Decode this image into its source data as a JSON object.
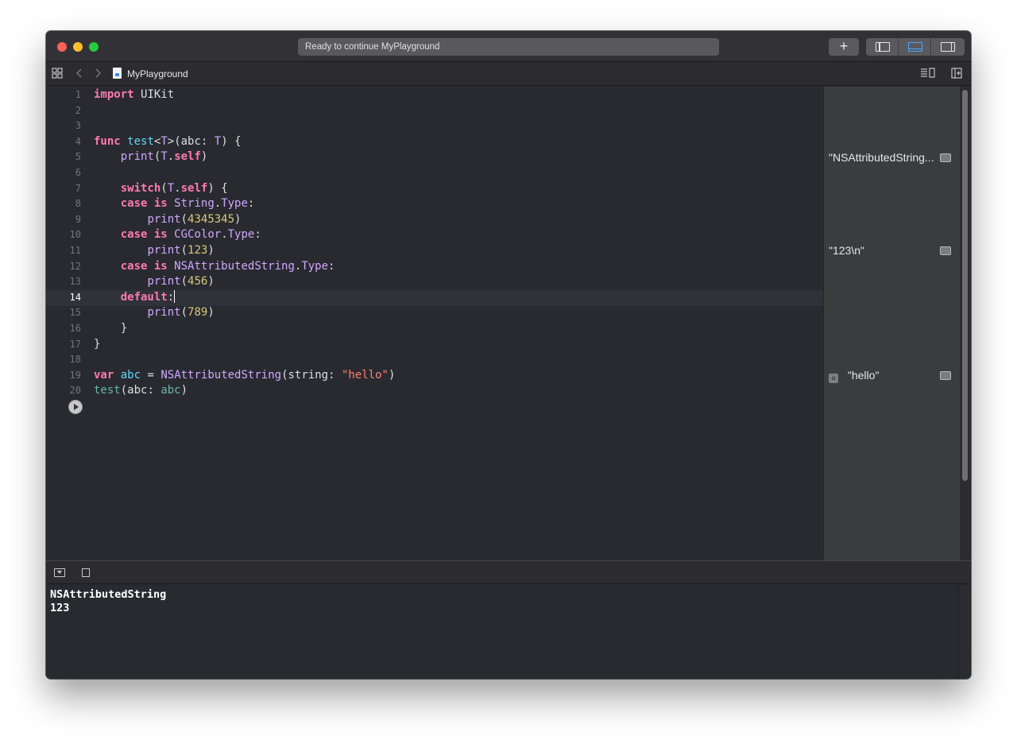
{
  "window": {
    "status": "Ready to continue MyPlayground",
    "add_button": "+"
  },
  "jumpbar": {
    "file_name": "MyPlayground",
    "grid_icon": "grid-icon",
    "back_icon": "chevron-left-icon",
    "forward_icon": "chevron-right-icon",
    "lines_icon": "editor-options-icon",
    "add_editor_icon": "add-editor-icon"
  },
  "editor": {
    "line_numbers": [
      "1",
      "2",
      "3",
      "4",
      "5",
      "6",
      "7",
      "8",
      "9",
      "10",
      "11",
      "12",
      "13",
      "14",
      "15",
      "16",
      "17",
      "18",
      "19",
      "20"
    ],
    "active_line": "14",
    "lines": [
      {
        "t": "import UIKit"
      },
      {
        "t": ""
      },
      {
        "t": ""
      },
      {
        "t": "func test<T>(abc: T) {"
      },
      {
        "t": "    print(T.self)"
      },
      {
        "t": ""
      },
      {
        "t": "    switch(T.self) {"
      },
      {
        "t": "    case is String.Type:"
      },
      {
        "t": "        print(4345345)"
      },
      {
        "t": "    case is CGColor.Type:"
      },
      {
        "t": "        print(123)"
      },
      {
        "t": "    case is NSAttributedString.Type:"
      },
      {
        "t": "        print(456)"
      },
      {
        "t": "    default:"
      },
      {
        "t": "        print(789)"
      },
      {
        "t": "    }"
      },
      {
        "t": "}"
      },
      {
        "t": ""
      },
      {
        "t": "var abc = NSAttributedString(string: \"hello\")"
      },
      {
        "t": "test(abc: abc)"
      }
    ]
  },
  "results": {
    "r1": "\"NSAttributedString...",
    "r2": "\"123\\n\"",
    "r3": "\"hello\"",
    "r3_badge": "a"
  },
  "console": {
    "lines": [
      "NSAttributedString",
      "123"
    ]
  },
  "colors": {
    "keyword": "#ff7ab2",
    "function": "#67b7a4",
    "declaration": "#5dd8ff",
    "type": "#d0a8ff",
    "number": "#d9c97c",
    "string": "#ff8170",
    "accent": "#4aa8ff"
  }
}
